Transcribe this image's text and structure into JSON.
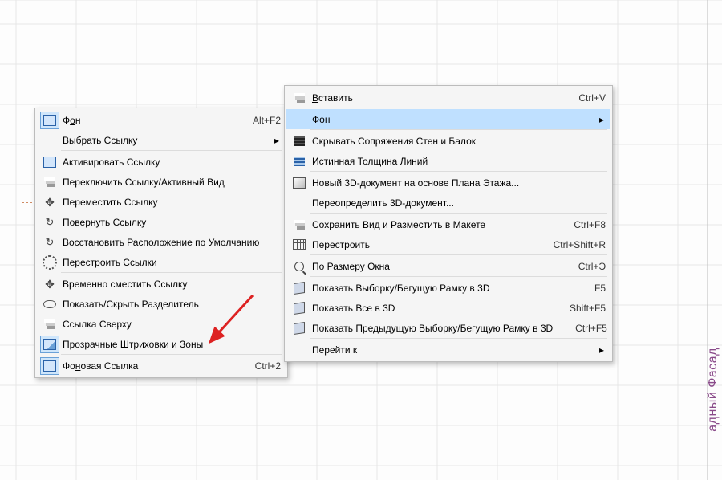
{
  "side_text": "адный Фасад",
  "menu1": {
    "items": [
      {
        "key": "bg",
        "label_html": "Ф<u>о</u>н",
        "accel": "Alt+F2",
        "icon": "box",
        "active_icon": true
      },
      {
        "key": "select_link",
        "label_html": "Выбрать Ссылку",
        "submenu": true,
        "sep_after": true
      },
      {
        "key": "activate",
        "label_html": "Активировать Ссылку",
        "icon": "box"
      },
      {
        "key": "toggle",
        "label_html": "Переключить Ссылку/Активный Вид",
        "icon": "layers"
      },
      {
        "key": "move",
        "label_html": "Переместить Ссылку",
        "icon": "move"
      },
      {
        "key": "rotate",
        "label_html": "Повернуть Ссылку",
        "icon": "rot"
      },
      {
        "key": "restore",
        "label_html": "Восстановить Расположение по Умолчанию",
        "icon": "rot"
      },
      {
        "key": "rebuild",
        "label_html": "Перестроить Ссылки",
        "icon": "gear",
        "sep_after": true
      },
      {
        "key": "offset",
        "label_html": "Временно сместить Ссылку",
        "icon": "move"
      },
      {
        "key": "split",
        "label_html": "Показать/Скрыть Разделитель",
        "icon": "eye"
      },
      {
        "key": "top",
        "label_html": "Ссылка Сверху",
        "icon": "layers"
      },
      {
        "key": "trans",
        "label_html": "Прозрачные Штриховки и Зоны",
        "icon": "box2",
        "active_icon": true,
        "sep_after": true
      },
      {
        "key": "bg_link",
        "label_html": "Фо<u>н</u>овая Ссылка",
        "accel": "Ctrl+2",
        "icon": "box",
        "active_icon": true
      }
    ]
  },
  "menu2": {
    "items": [
      {
        "key": "paste",
        "label_html": "<u>В</u>ставить",
        "accel": "Ctrl+V",
        "icon": "layers",
        "sep_after": true
      },
      {
        "key": "bg",
        "label_html": "Ф<u>о</u>н",
        "submenu": true,
        "selected": true,
        "sep_after": true
      },
      {
        "key": "hide_joints",
        "label_html": "Скрывать Сопряжения Стен и Балок",
        "icon": "stripes-dk"
      },
      {
        "key": "true_thick",
        "label_html": "Истинная Толщина Линий",
        "icon": "stripes-bl",
        "sep_after": true
      },
      {
        "key": "new3d",
        "label_html": "Новый 3D-документ на основе Плана Этажа...",
        "icon": "3d"
      },
      {
        "key": "redef3d",
        "label_html": "Переопределить 3D-документ...",
        "sep_after": true
      },
      {
        "key": "save_view",
        "label_html": "Сохранить Вид и Разместить в Макете",
        "accel": "Ctrl+F8",
        "icon": "layers"
      },
      {
        "key": "rebuild",
        "label_html": "Перестроить",
        "accel": "Ctrl+Shift+R",
        "icon": "grid",
        "sep_after": true
      },
      {
        "key": "fit",
        "label_html": "По <u>Р</u>азмеру Окна",
        "accel": "Ctrl+Э",
        "icon": "magnify",
        "sep_after": true
      },
      {
        "key": "sel3d",
        "label_html": "Показать Выборку/Бегущую Рамку в 3D",
        "accel": "F5",
        "icon": "cube"
      },
      {
        "key": "all3d",
        "label_html": "Показать Все в 3D",
        "accel": "Shift+F5",
        "icon": "cube"
      },
      {
        "key": "prev3d",
        "label_html": "Показать Предыдущую Выборку/Бегущую Рамку в 3D",
        "accel": "Ctrl+F5",
        "icon": "cube",
        "sep_after": true
      },
      {
        "key": "goto",
        "label_html": "Перейти к",
        "submenu": true
      }
    ]
  }
}
